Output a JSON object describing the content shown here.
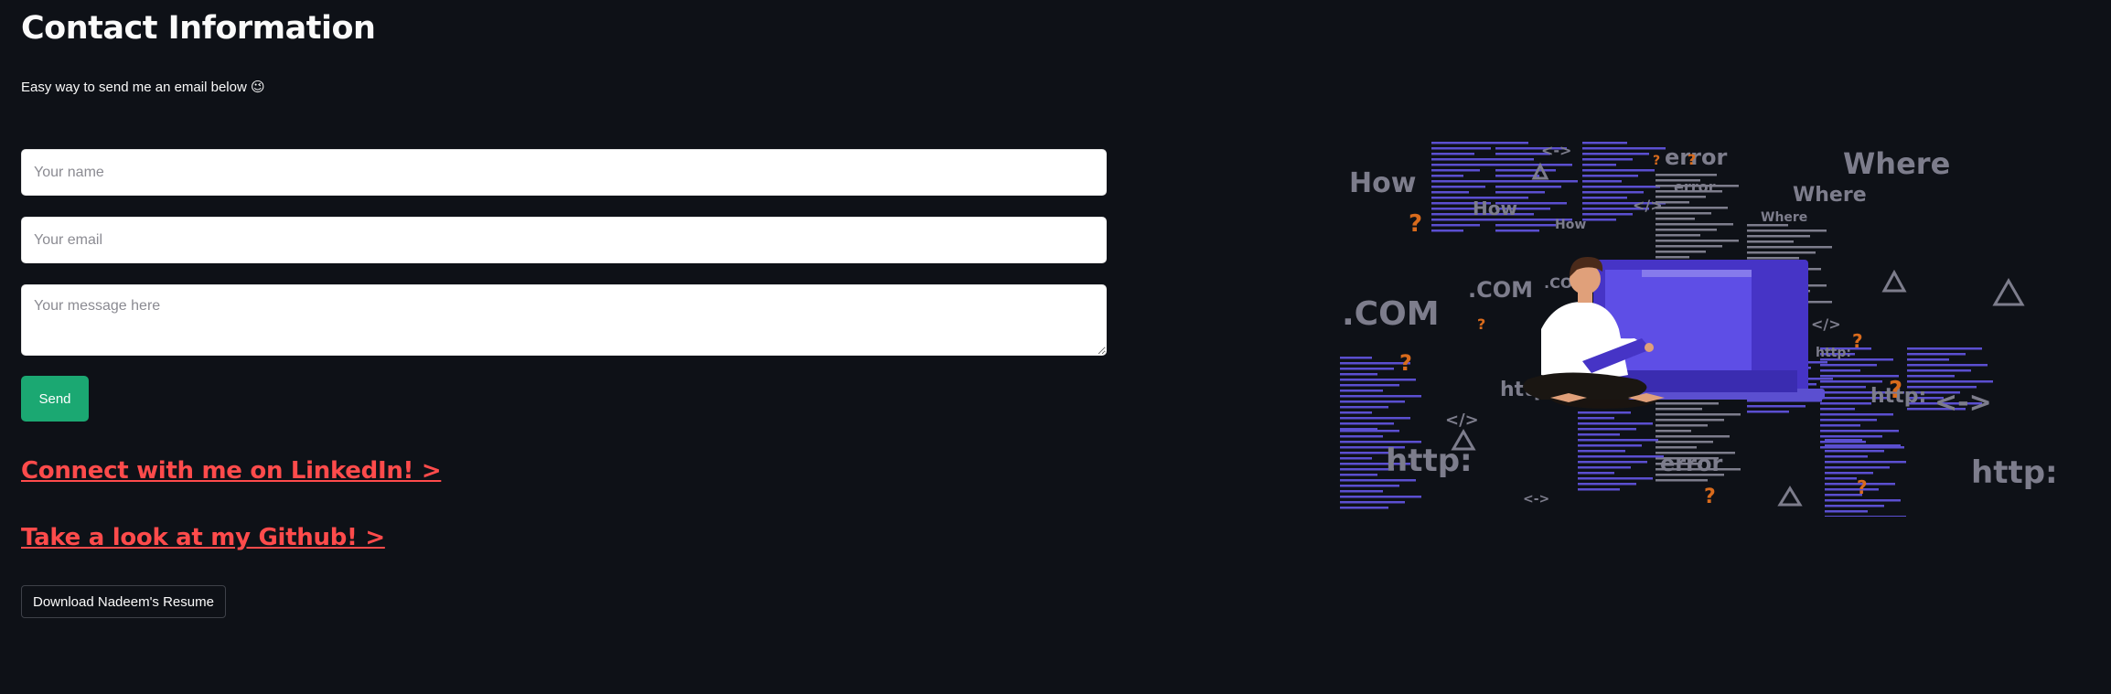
{
  "page": {
    "title": "Contact Information",
    "subtitle": "Easy way to send me an email below 😉"
  },
  "form": {
    "name_placeholder": "Your name",
    "email_placeholder": "Your email",
    "message_placeholder": "Your message here",
    "send_label": "Send"
  },
  "links": {
    "linkedin": "Connect with me on LinkedIn! >",
    "github": "Take a look at my Github! >"
  },
  "resume": {
    "button_label": "Download Nadeem's Resume"
  },
  "illustration": {
    "words": [
      "How",
      "How",
      "How",
      "Where",
      "Where",
      "Where",
      "error",
      "error",
      "error",
      ".COM",
      ".COM",
      ".COM",
      "http:",
      "http:",
      "http:",
      "http:",
      "http:",
      "<->",
      "<->",
      "<->",
      "</>",
      "</>",
      "</>",
      "?",
      "?",
      "?",
      "?",
      "?",
      "?",
      "?",
      "?",
      "?"
    ],
    "colors": {
      "background": "#0e1117",
      "accent": "#1ba872",
      "link": "#ff4b4b",
      "code_lines_purple": "#5b4fd0",
      "code_lines_gray": "#7d7d8c",
      "question_mark": "#d96b1c",
      "laptop": "#4634c6"
    }
  }
}
